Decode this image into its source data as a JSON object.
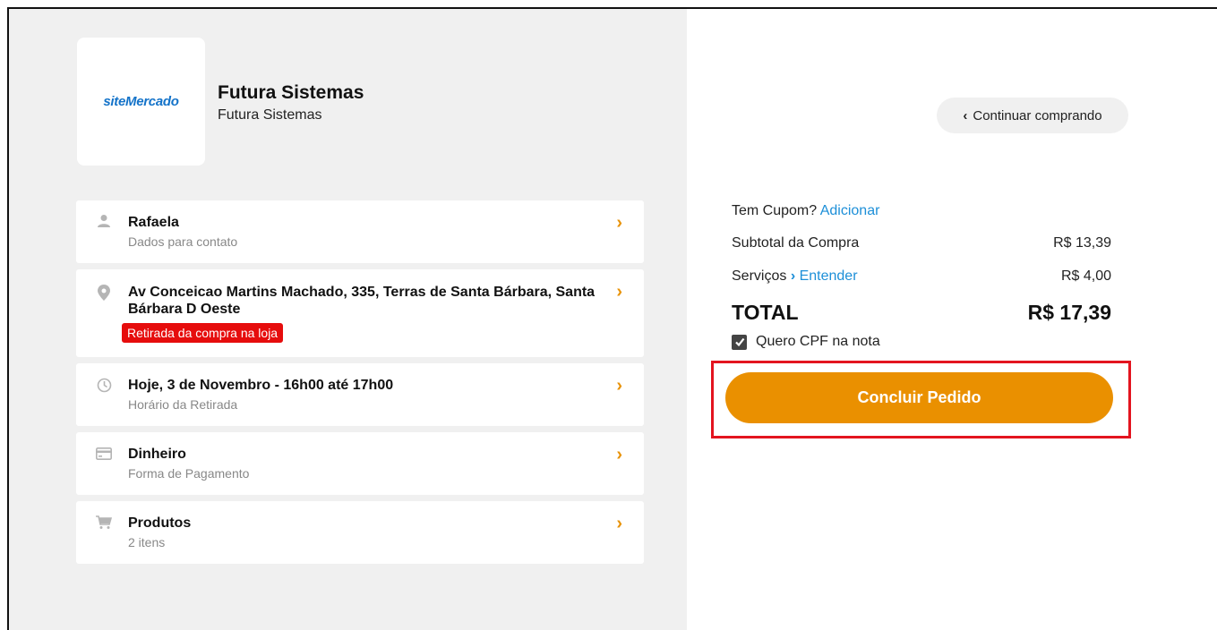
{
  "store": {
    "logo_text": "siteMercado",
    "name": "Futura Sistemas",
    "subtitle": "Futura Sistemas"
  },
  "cards": [
    {
      "title": "Rafaela",
      "subtitle": "Dados para contato",
      "icon": "user-icon"
    },
    {
      "title": "Av Conceicao Martins Machado, 335, Terras de Santa Bárbara, Santa Bárbara D Oeste",
      "tag": "Retirada da compra na loja",
      "icon": "location-pin-icon"
    },
    {
      "title": "Hoje, 3 de Novembro - 16h00 até 17h00",
      "subtitle": "Horário da Retirada",
      "icon": "clock-icon"
    },
    {
      "title": "Dinheiro",
      "subtitle": "Forma de Pagamento",
      "icon": "payment-card-icon"
    },
    {
      "title": "Produtos",
      "subtitle": "2 itens",
      "icon": "cart-icon"
    }
  ],
  "summary": {
    "continue_label": "Continuar comprando",
    "coupon_label": "Tem Cupom?",
    "coupon_link": "Adicionar",
    "subtotal_label": "Subtotal da Compra",
    "subtotal_value": "R$ 13,39",
    "services_label": "Serviços",
    "services_link": "Entender",
    "services_value": "R$ 4,00",
    "total_label": "TOTAL",
    "total_value": "R$ 17,39",
    "cpf_label": "Quero CPF na nota",
    "cpf_checked": true,
    "submit_label": "Concluir Pedido"
  },
  "colors": {
    "accent": "#ea9000",
    "link": "#1d8fd8",
    "tag_red": "#e60d0d",
    "highlight_border": "#e3141f"
  }
}
